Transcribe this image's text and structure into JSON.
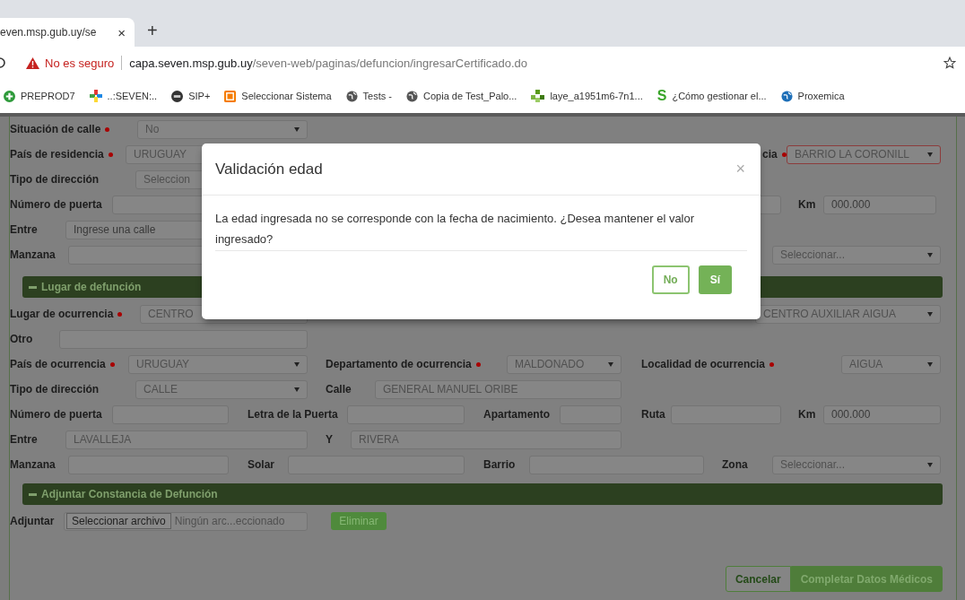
{
  "browser": {
    "tab": {
      "title": "even.msp.gub.uy/se",
      "close": "×"
    },
    "new_tab": "+",
    "security": "No es seguro",
    "url_host": "capa.seven.msp.gub.uy",
    "url_path": "/seven-web/paginas/defuncion/ingresarCertificado.do",
    "bookmarks": [
      {
        "label": "PREPROD7",
        "kind": "plus"
      },
      {
        "label": "..:SEVEN:..",
        "kind": "cross"
      },
      {
        "label": "SIP+",
        "kind": "disc"
      },
      {
        "label": "Seleccionar Sistema",
        "kind": "square"
      },
      {
        "label": "Tests -",
        "kind": "globe"
      },
      {
        "label": "Copia de Test_Palo...",
        "kind": "globe"
      },
      {
        "label": "laye_a1951m6-7n1...",
        "kind": "tree"
      },
      {
        "label": "¿Cómo gestionar el...",
        "kind": "letter",
        "glyph": "S"
      },
      {
        "label": "Proxemica",
        "kind": "globe"
      }
    ]
  },
  "form": {
    "sections": [
      {
        "rows": [
          {
            "fields": [
              {
                "label": "Situación de calle",
                "required": true,
                "kind": "select",
                "value": "No"
              }
            ]
          },
          {
            "fields": [
              {
                "label": "País de residencia",
                "required": true,
                "kind": "select",
                "value": "URUGUAY"
              },
              {
                "label": "cia",
                "required": true,
                "kind": "select",
                "value": "BARRIO LA CORONILL",
                "invalid": true
              }
            ]
          },
          {
            "fields": [
              {
                "label": "Tipo de dirección",
                "required": false,
                "kind": "select",
                "value": "Seleccion"
              }
            ]
          },
          {
            "fields": [
              {
                "label": "Número de puerta",
                "required": false,
                "kind": "input"
              },
              {
                "kind": "input"
              },
              {
                "label": "Km",
                "required": false,
                "kind": "input",
                "placeholder": "000.000"
              }
            ]
          },
          {
            "fields": [
              {
                "label": "Entre",
                "required": false,
                "kind": "input",
                "placeholder": "Ingrese una calle"
              }
            ]
          },
          {
            "fields": [
              {
                "label": "Manzana",
                "required": false,
                "kind": "input"
              },
              {
                "kind": "select",
                "value": "Seleccionar..."
              }
            ]
          }
        ]
      },
      {
        "title": "Lugar de defunción",
        "expanded": true,
        "rows": [
          {
            "fields": [
              {
                "label": "Lugar de ocurrencia",
                "required": true,
                "kind": "select",
                "value": "CENTRO"
              },
              {
                "kind": "select",
                "value": "CENTRO AUXILIAR AIGUA"
              }
            ]
          },
          {
            "fields": [
              {
                "label": "Otro",
                "required": false,
                "kind": "input"
              }
            ]
          },
          {
            "fields": [
              {
                "label": "País de ocurrencia",
                "required": true,
                "kind": "select",
                "value": "URUGUAY"
              },
              {
                "label": "Departamento de ocurrencia",
                "required": true,
                "kind": "select",
                "value": "MALDONADO"
              },
              {
                "label": "Localidad de ocurrencia",
                "required": true,
                "kind": "select",
                "value": "AIGUA"
              }
            ]
          },
          {
            "fields": [
              {
                "label": "Tipo de dirección",
                "required": false,
                "kind": "select",
                "value": "CALLE"
              },
              {
                "label": "Calle",
                "required": false,
                "kind": "input",
                "value": "GENERAL MANUEL ORIBE"
              }
            ]
          },
          {
            "fields": [
              {
                "label": "Número de puerta",
                "required": false,
                "kind": "input"
              },
              {
                "label": "Letra de la Puerta",
                "required": false,
                "kind": "input"
              },
              {
                "label": "Apartamento",
                "required": false,
                "kind": "input"
              },
              {
                "label": "Ruta",
                "required": false,
                "kind": "input"
              },
              {
                "label": "Km",
                "required": false,
                "kind": "input",
                "placeholder": "000.000"
              }
            ]
          },
          {
            "fields": [
              {
                "label": "Entre",
                "required": false,
                "kind": "input",
                "value": "LAVALLEJA"
              },
              {
                "label": "Y",
                "required": false,
                "kind": "input",
                "value": "RIVERA"
              }
            ]
          },
          {
            "fields": [
              {
                "label": "Manzana",
                "required": false,
                "kind": "input"
              },
              {
                "label": "Solar",
                "required": false,
                "kind": "input"
              },
              {
                "label": "Barrio",
                "required": false,
                "kind": "input"
              },
              {
                "label": "Zona",
                "required": false,
                "kind": "select",
                "value": "Seleccionar..."
              }
            ]
          }
        ]
      },
      {
        "title": "Adjuntar Constancia de Defunción",
        "expanded": true,
        "rows": [
          {
            "fields": [
              {
                "label": "Adjuntar",
                "required": false,
                "kind": "file",
                "button": "Seleccionar archivo",
                "value": "Ningún arc...eccionado"
              },
              {
                "kind": "button",
                "text": "Eliminar"
              }
            ]
          }
        ]
      }
    ],
    "actions": [
      {
        "label": "Cancelar",
        "primary": false
      },
      {
        "label": "Completar Datos Médicos",
        "primary": true
      }
    ]
  },
  "modal": {
    "title": "Validación edad",
    "close": "×",
    "message": "La edad ingresada no se corresponde con la fecha de nacimiento. ¿Desea mantener el valor ingresado?",
    "buttons": [
      {
        "label": "No",
        "primary": false
      },
      {
        "label": "Sí",
        "primary": true
      }
    ]
  }
}
